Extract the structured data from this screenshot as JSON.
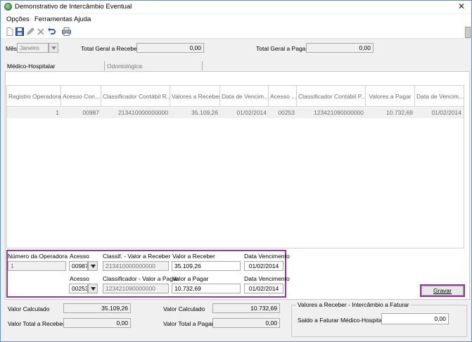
{
  "window": {
    "title": "Demonstrativo de Intercâmbio Eventual",
    "close_glyph": "✕"
  },
  "menu": [
    "Opções",
    "Ferramentas",
    "Ajuda"
  ],
  "toolbar": {
    "icons": [
      "new-document-icon",
      "save-icon",
      "edit-icon",
      "delete-icon",
      "undo-icon",
      "print-icon"
    ]
  },
  "filters": {
    "mes_label": "Mês",
    "mes_value": "Janeiro",
    "total_receber_label": "Total Geral a Receber:",
    "total_receber_value": "0,00",
    "total_pagar_label": "Total Geral a Pagar:",
    "total_pagar_value": "0,00"
  },
  "tabs": [
    "Médico-Hospitalar",
    "Odontológica"
  ],
  "grid": {
    "columns": [
      "Registro Operadora",
      "Acesso Con...",
      "Classificador Contábil R...",
      "Valores a Receber",
      "Data de Vencim...",
      "Acesso ...",
      "Classificador Contábil P...",
      "Valores a Pagar",
      "Data de Vencim..."
    ],
    "rows": [
      [
        "1",
        "00987",
        "213410000000000",
        "35.109,26",
        "01/02/2014",
        "00253",
        "123421090000000",
        "10.732,69",
        "01/02/2014"
      ]
    ]
  },
  "form": {
    "numero_operadora_label": "Número da Operadora",
    "numero_operadora_value": "1",
    "acesso_label_1": "Acesso",
    "acesso_value_1": "00987",
    "classif_receber_label": "Classif. - Valor a Receber",
    "classif_receber_value": "213410000000000",
    "valor_receber_label": "Valor a Receber",
    "valor_receber_value": "35.109,26",
    "data_venc_label_1": "Data Vencimento",
    "data_venc_value_1": "01/02/2014",
    "acesso_label_2": "Acesso",
    "acesso_value_2": "00253",
    "classif_pagar_label": "Classificador - Valor a Pagar",
    "classif_pagar_value": "123421090000000",
    "valor_pagar_label": "Valor a Pagar",
    "valor_pagar_value": "10.732,69",
    "data_venc_label_2": "Data Vencimento",
    "data_venc_value_2": "01/02/2014",
    "gravar_label": "Gravar"
  },
  "summary": {
    "valor_calc_label_1": "Valor Calculado",
    "valor_calc_value_1": "35.109,26",
    "valor_total_receber_label": "Valor Total a Receber",
    "valor_total_receber_value": "0,00",
    "valor_calc_label_2": "Valor Calculado",
    "valor_calc_value_2": "10.732,69",
    "valor_total_pagar_label": "Valor Total a Pagar",
    "valor_total_pagar_value": "0,00",
    "group_title": "Valores a Receber - Intercâmbio a Faturar",
    "saldo_label": "Saldo a Faturar Médico-Hospitalar",
    "saldo_value": "0,00"
  },
  "colors": {
    "highlight": "#8e3d96",
    "window_border": "#6a8fb6"
  }
}
